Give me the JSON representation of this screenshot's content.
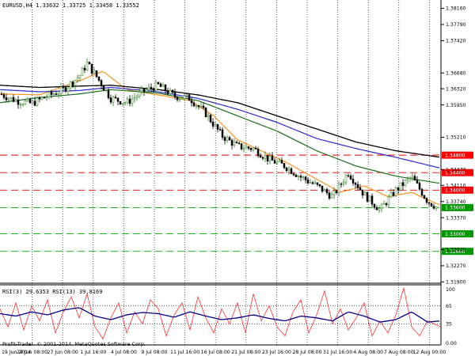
{
  "header": {
    "main": "EURUSD,H4  1.33632 1.33725 1.33458 1.33552",
    "rsi": "RSI(3) 29.6353  RSI(13) 39.8169",
    "copyright": "Profit-Trader, © 2001-2014, MetaQuotes Software Corp."
  },
  "colors": {
    "background": "#ffffff",
    "grid": "#000000",
    "candle_bull": "#2e7d1f",
    "candle_bear": "#000000",
    "ma_orange": "#f7931e",
    "ma_green": "#1a6b1a",
    "ma_blue": "#2a2ad0",
    "ma_black": "#000000",
    "red_level": "#e00000",
    "green_level": "#00aa00",
    "rsi_fast": "#ff3030",
    "rsi_slow": "#00008b"
  },
  "chart_data": [
    {
      "type": "line",
      "title": "EURUSD,H4",
      "ylim": [
        1.3187,
        1.3835
      ],
      "y_ticks": [
        "1.38160",
        "1.37790",
        "1.37420",
        "1.36680",
        "1.36320",
        "1.35950",
        "1.35210",
        "1.34470",
        "1.34110",
        "1.33740",
        "1.33370",
        "1.32640",
        "1.32270",
        "1.31900"
      ],
      "x_ticks": [
        "19 Jun 2014",
        "24 Jun 08:00",
        "27 Jun 08:00",
        "1 Jul 16:00",
        "4 Jul 08:00",
        "9 Jul 08:00",
        "11 Jul 16:00",
        "16 Jul 08:00",
        "21 Jul 08:00",
        "23 Jul 16:00",
        "28 Jul 08:00",
        "31 Jul 16:00",
        "4 Aug 08:00",
        "7 Aug 08:00",
        "12 Aug 00:00"
      ],
      "levels": [
        {
          "value": 1.348,
          "label": "1.34800",
          "color": "red"
        },
        {
          "value": 1.344,
          "label": "1.34400",
          "color": "red"
        },
        {
          "value": 1.34,
          "label": "1.34000",
          "color": "red"
        },
        {
          "value": 1.336,
          "label": "1.33600",
          "color": "green"
        },
        {
          "value": 1.33,
          "label": "1.33000",
          "color": "green"
        },
        {
          "value": 1.326,
          "label": "1.32600",
          "color": "green"
        }
      ],
      "series": [
        {
          "kind": "price",
          "x": [
            0,
            20,
            40,
            60,
            80,
            100,
            110,
            120,
            140,
            160,
            180,
            200,
            220,
            240,
            260,
            280,
            300,
            320,
            340,
            360,
            380,
            400,
            420,
            440,
            460,
            480,
            500,
            520,
            540,
            557
          ],
          "values": [
            1.362,
            1.3605,
            1.3598,
            1.3615,
            1.363,
            1.366,
            1.369,
            1.3665,
            1.361,
            1.36,
            1.3625,
            1.364,
            1.3615,
            1.361,
            1.3575,
            1.3525,
            1.35,
            1.3495,
            1.347,
            1.3455,
            1.343,
            1.341,
            1.3385,
            1.344,
            1.339,
            1.3355,
            1.34,
            1.343,
            1.3375,
            1.3355
          ]
        },
        {
          "kind": "ma",
          "color": "orange",
          "x": [
            0,
            50,
            100,
            130,
            160,
            200,
            240,
            270,
            300,
            330,
            360,
            400,
            430,
            460,
            490,
            520,
            540,
            557
          ],
          "values": [
            1.362,
            1.3618,
            1.365,
            1.3672,
            1.363,
            1.3618,
            1.3605,
            1.357,
            1.3515,
            1.349,
            1.3465,
            1.3425,
            1.3395,
            1.341,
            1.3385,
            1.3395,
            1.3378,
            1.3365
          ]
        },
        {
          "kind": "ma",
          "color": "green",
          "x": [
            0,
            50,
            100,
            140,
            200,
            250,
            300,
            350,
            400,
            450,
            500,
            557
          ],
          "values": [
            1.36,
            1.3612,
            1.362,
            1.363,
            1.3622,
            1.3605,
            1.357,
            1.3535,
            1.349,
            1.3455,
            1.3432,
            1.3415
          ]
        },
        {
          "kind": "ma",
          "color": "blue",
          "x": [
            0,
            50,
            100,
            140,
            200,
            250,
            300,
            350,
            400,
            450,
            500,
            557
          ],
          "values": [
            1.363,
            1.3625,
            1.3628,
            1.3635,
            1.3625,
            1.361,
            1.3585,
            1.3555,
            1.3518,
            1.3495,
            1.3475,
            1.345
          ]
        },
        {
          "kind": "ma",
          "color": "black",
          "x": [
            0,
            50,
            100,
            140,
            200,
            250,
            300,
            350,
            400,
            450,
            500,
            557
          ],
          "values": [
            1.364,
            1.3635,
            1.3638,
            1.364,
            1.363,
            1.3618,
            1.36,
            1.357,
            1.354,
            1.351,
            1.349,
            1.3475
          ]
        }
      ]
    },
    {
      "type": "line",
      "title": "RSI(3) 29.6353  RSI(13) 39.8169",
      "ylim": [
        0,
        100
      ],
      "y_ticks": [
        "65",
        "35",
        "100",
        "0.00"
      ],
      "y_tick_values": [
        65,
        35,
        100,
        0
      ],
      "series": [
        {
          "name": "RSI(3)",
          "color": "red",
          "x": [
            0,
            10,
            20,
            30,
            40,
            50,
            60,
            70,
            80,
            90,
            100,
            110,
            120,
            130,
            140,
            150,
            160,
            170,
            180,
            190,
            200,
            210,
            220,
            230,
            240,
            250,
            260,
            270,
            280,
            290,
            300,
            310,
            320,
            330,
            340,
            350,
            360,
            370,
            380,
            390,
            400,
            410,
            420,
            430,
            440,
            450,
            460,
            470,
            480,
            490,
            500,
            510,
            520,
            530,
            540,
            557
          ],
          "values": [
            60,
            30,
            70,
            25,
            65,
            40,
            75,
            20,
            55,
            80,
            45,
            85,
            30,
            10,
            45,
            70,
            20,
            55,
            35,
            75,
            60,
            15,
            50,
            70,
            25,
            80,
            45,
            20,
            60,
            35,
            70,
            20,
            85,
            40,
            65,
            30,
            15,
            55,
            75,
            20,
            50,
            90,
            35,
            60,
            25,
            45,
            70,
            15,
            40,
            20,
            50,
            95,
            30,
            15,
            40,
            30
          ]
        },
        {
          "name": "RSI(13)",
          "color": "navy",
          "x": [
            0,
            20,
            40,
            60,
            80,
            100,
            120,
            140,
            160,
            180,
            200,
            220,
            240,
            260,
            280,
            300,
            320,
            340,
            360,
            380,
            400,
            420,
            440,
            460,
            480,
            500,
            520,
            540,
            557
          ],
          "values": [
            52,
            48,
            55,
            50,
            58,
            62,
            48,
            42,
            50,
            54,
            52,
            46,
            55,
            48,
            42,
            45,
            50,
            44,
            40,
            48,
            45,
            40,
            55,
            48,
            38,
            42,
            55,
            38,
            40
          ]
        }
      ]
    }
  ]
}
